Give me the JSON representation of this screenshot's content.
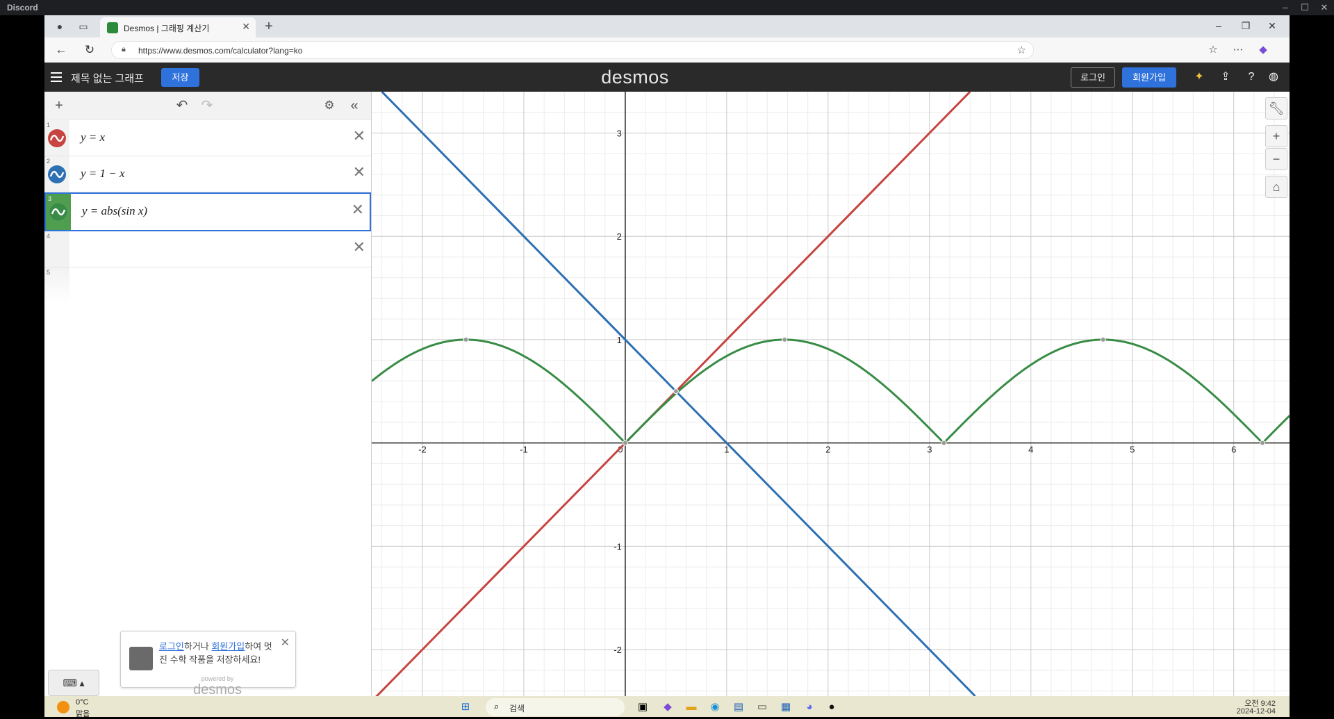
{
  "discord": {
    "title": "Discord"
  },
  "browser": {
    "tab_title": "Desmos | 그래핑 계산기",
    "url": "https://www.desmos.com/calculator?lang=ko"
  },
  "desmos": {
    "graph_title": "제목 없는 그래프",
    "save_label": "저장",
    "logo": "desmos",
    "login_label": "로그인",
    "signup_label": "회원가입",
    "expressions": [
      {
        "num": "1",
        "latex": "y = x",
        "color": "#c74440"
      },
      {
        "num": "2",
        "latex": "y = 1 − x",
        "color": "#2d70b3"
      },
      {
        "num": "3",
        "latex": "y = abs(sin x)",
        "color": "#388c46"
      },
      {
        "num": "4",
        "latex": ""
      },
      {
        "num": "5",
        "latex": ""
      }
    ],
    "promo": {
      "login_link": "로그인",
      "mid": "하거나 ",
      "signup_link": "회원가입",
      "rest": "하여 멋진 수학 작품을 저장하세요!"
    },
    "powered_by": "powered by",
    "powered_logo": "desmos"
  },
  "graph": {
    "x_ticks": [
      "-2",
      "-1",
      "0",
      "1",
      "2",
      "3",
      "4",
      "5",
      "6"
    ],
    "y_ticks": [
      "3",
      "2",
      "1",
      "-1",
      "-2"
    ]
  },
  "chart_data": {
    "type": "line",
    "xlim": [
      -2.5,
      6.55
    ],
    "ylim": [
      -2.45,
      3.4
    ],
    "grid": true,
    "series": [
      {
        "name": "y = x",
        "color": "#c74440",
        "x": [
          -2.5,
          3.4
        ],
        "y": [
          -2.5,
          3.4
        ]
      },
      {
        "name": "y = 1 − x",
        "color": "#2d70b3",
        "x": [
          -2.4,
          3.45
        ],
        "y": [
          3.4,
          -2.45
        ]
      },
      {
        "name": "y = abs(sin x)",
        "color": "#388c46",
        "function": "abs(sin(x))"
      }
    ],
    "points": [
      {
        "x": 0.5,
        "y": 0.5
      },
      {
        "x": -1.571,
        "y": 1
      },
      {
        "x": 1.571,
        "y": 1
      },
      {
        "x": 4.712,
        "y": 1
      },
      {
        "x": 0,
        "y": 0
      },
      {
        "x": 3.1416,
        "y": 0
      },
      {
        "x": 6.2832,
        "y": 0
      }
    ]
  },
  "taskbar": {
    "temp": "0°C",
    "weather": "맑음",
    "search_placeholder": "검색",
    "time": "오전 9:42",
    "date": "2024-12-04"
  }
}
